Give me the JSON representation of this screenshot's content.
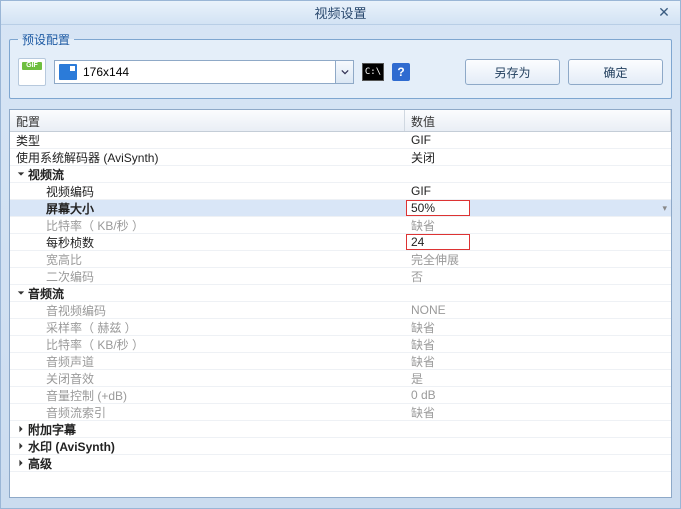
{
  "window": {
    "title": "视频设置"
  },
  "preset": {
    "legend": "预设配置",
    "resolution": "176x144",
    "cmd_text": "C:\\",
    "help_text": "?",
    "save_as": "另存为",
    "ok": "确定"
  },
  "columns": {
    "config": "配置",
    "value": "数值"
  },
  "rows": {
    "type_label": "类型",
    "type_value": "GIF",
    "decoder_label": "使用系统解码器 (AviSynth)",
    "decoder_value": "关闭",
    "video_stream": "视频流",
    "video_codec_label": "视频编码",
    "video_codec_value": "GIF",
    "screen_size_label": "屏幕大小",
    "screen_size_value": "50%",
    "bitrate_label": "比特率（ KB/秒 ）",
    "bitrate_value": "缺省",
    "fps_label": "每秒桢数",
    "fps_value": "24",
    "aspect_label": "宽高比",
    "aspect_value": "完全伸展",
    "secondary_label": "二次编码",
    "secondary_value": "否",
    "audio_stream": "音频流",
    "av_codec_label": "音视频编码",
    "av_codec_value": "NONE",
    "sample_label": "采样率（ 赫兹 ）",
    "sample_value": "缺省",
    "a_bitrate_label": "比特率（ KB/秒 ）",
    "a_bitrate_value": "缺省",
    "channels_label": "音频声道",
    "channels_value": "缺省",
    "mute_label": "关闭音效",
    "mute_value": "是",
    "volume_label": "音量控制 (+dB)",
    "volume_value": "0 dB",
    "audio_index_label": "音频流索引",
    "audio_index_value": "缺省",
    "subtitle": "附加字幕",
    "watermark": "水印 (AviSynth)",
    "advanced": "高级"
  }
}
